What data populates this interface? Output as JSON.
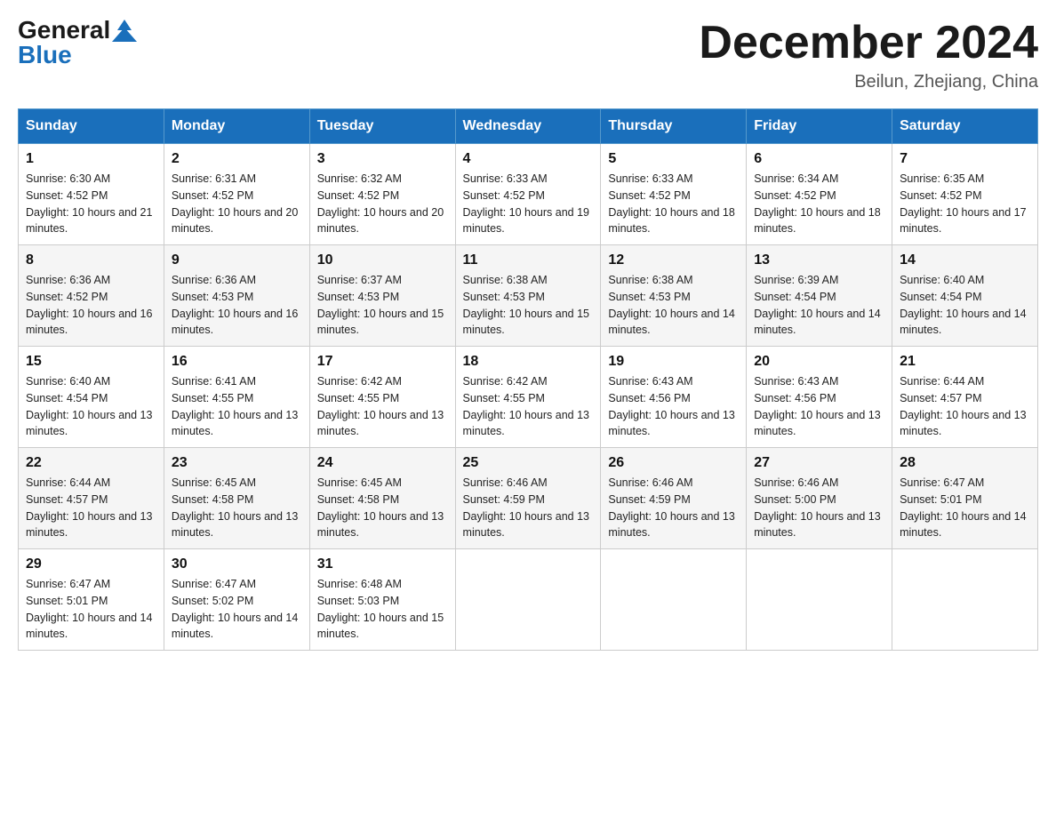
{
  "logo": {
    "general": "General",
    "blue": "Blue"
  },
  "title": "December 2024",
  "location": "Beilun, Zhejiang, China",
  "days_of_week": [
    "Sunday",
    "Monday",
    "Tuesday",
    "Wednesday",
    "Thursday",
    "Friday",
    "Saturday"
  ],
  "weeks": [
    [
      {
        "day": 1,
        "sunrise": "6:30 AM",
        "sunset": "4:52 PM",
        "daylight": "10 hours and 21 minutes."
      },
      {
        "day": 2,
        "sunrise": "6:31 AM",
        "sunset": "4:52 PM",
        "daylight": "10 hours and 20 minutes."
      },
      {
        "day": 3,
        "sunrise": "6:32 AM",
        "sunset": "4:52 PM",
        "daylight": "10 hours and 20 minutes."
      },
      {
        "day": 4,
        "sunrise": "6:33 AM",
        "sunset": "4:52 PM",
        "daylight": "10 hours and 19 minutes."
      },
      {
        "day": 5,
        "sunrise": "6:33 AM",
        "sunset": "4:52 PM",
        "daylight": "10 hours and 18 minutes."
      },
      {
        "day": 6,
        "sunrise": "6:34 AM",
        "sunset": "4:52 PM",
        "daylight": "10 hours and 18 minutes."
      },
      {
        "day": 7,
        "sunrise": "6:35 AM",
        "sunset": "4:52 PM",
        "daylight": "10 hours and 17 minutes."
      }
    ],
    [
      {
        "day": 8,
        "sunrise": "6:36 AM",
        "sunset": "4:52 PM",
        "daylight": "10 hours and 16 minutes."
      },
      {
        "day": 9,
        "sunrise": "6:36 AM",
        "sunset": "4:53 PM",
        "daylight": "10 hours and 16 minutes."
      },
      {
        "day": 10,
        "sunrise": "6:37 AM",
        "sunset": "4:53 PM",
        "daylight": "10 hours and 15 minutes."
      },
      {
        "day": 11,
        "sunrise": "6:38 AM",
        "sunset": "4:53 PM",
        "daylight": "10 hours and 15 minutes."
      },
      {
        "day": 12,
        "sunrise": "6:38 AM",
        "sunset": "4:53 PM",
        "daylight": "10 hours and 14 minutes."
      },
      {
        "day": 13,
        "sunrise": "6:39 AM",
        "sunset": "4:54 PM",
        "daylight": "10 hours and 14 minutes."
      },
      {
        "day": 14,
        "sunrise": "6:40 AM",
        "sunset": "4:54 PM",
        "daylight": "10 hours and 14 minutes."
      }
    ],
    [
      {
        "day": 15,
        "sunrise": "6:40 AM",
        "sunset": "4:54 PM",
        "daylight": "10 hours and 13 minutes."
      },
      {
        "day": 16,
        "sunrise": "6:41 AM",
        "sunset": "4:55 PM",
        "daylight": "10 hours and 13 minutes."
      },
      {
        "day": 17,
        "sunrise": "6:42 AM",
        "sunset": "4:55 PM",
        "daylight": "10 hours and 13 minutes."
      },
      {
        "day": 18,
        "sunrise": "6:42 AM",
        "sunset": "4:55 PM",
        "daylight": "10 hours and 13 minutes."
      },
      {
        "day": 19,
        "sunrise": "6:43 AM",
        "sunset": "4:56 PM",
        "daylight": "10 hours and 13 minutes."
      },
      {
        "day": 20,
        "sunrise": "6:43 AM",
        "sunset": "4:56 PM",
        "daylight": "10 hours and 13 minutes."
      },
      {
        "day": 21,
        "sunrise": "6:44 AM",
        "sunset": "4:57 PM",
        "daylight": "10 hours and 13 minutes."
      }
    ],
    [
      {
        "day": 22,
        "sunrise": "6:44 AM",
        "sunset": "4:57 PM",
        "daylight": "10 hours and 13 minutes."
      },
      {
        "day": 23,
        "sunrise": "6:45 AM",
        "sunset": "4:58 PM",
        "daylight": "10 hours and 13 minutes."
      },
      {
        "day": 24,
        "sunrise": "6:45 AM",
        "sunset": "4:58 PM",
        "daylight": "10 hours and 13 minutes."
      },
      {
        "day": 25,
        "sunrise": "6:46 AM",
        "sunset": "4:59 PM",
        "daylight": "10 hours and 13 minutes."
      },
      {
        "day": 26,
        "sunrise": "6:46 AM",
        "sunset": "4:59 PM",
        "daylight": "10 hours and 13 minutes."
      },
      {
        "day": 27,
        "sunrise": "6:46 AM",
        "sunset": "5:00 PM",
        "daylight": "10 hours and 13 minutes."
      },
      {
        "day": 28,
        "sunrise": "6:47 AM",
        "sunset": "5:01 PM",
        "daylight": "10 hours and 14 minutes."
      }
    ],
    [
      {
        "day": 29,
        "sunrise": "6:47 AM",
        "sunset": "5:01 PM",
        "daylight": "10 hours and 14 minutes."
      },
      {
        "day": 30,
        "sunrise": "6:47 AM",
        "sunset": "5:02 PM",
        "daylight": "10 hours and 14 minutes."
      },
      {
        "day": 31,
        "sunrise": "6:48 AM",
        "sunset": "5:03 PM",
        "daylight": "10 hours and 15 minutes."
      },
      null,
      null,
      null,
      null
    ]
  ]
}
